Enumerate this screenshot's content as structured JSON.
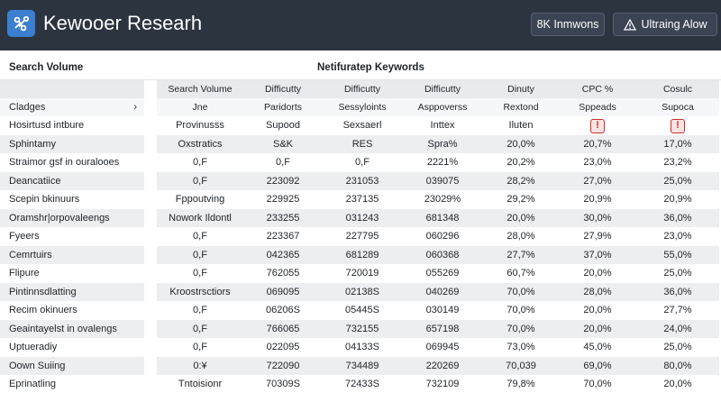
{
  "app": {
    "title": "Kewooer Researh",
    "logo_icon": "share-network-icon",
    "accent": "#3a7fd0",
    "topbar_bg": "#2c3440"
  },
  "toolbar": {
    "immwons_label": "8K Inmwons",
    "alow_label": "Ultraing Alow",
    "alow_icon": "warning-triangle-icon"
  },
  "sections": {
    "left_label": "Search Volume",
    "center_label": "Netifuratep Keywords"
  },
  "table": {
    "category_label": "Cladges",
    "columns": [
      "Search Volume",
      "Difficutty",
      "Difficutty",
      "Difficutty",
      "Dinuty",
      "CPC %",
      "Cosulc"
    ],
    "sub_headers": [
      "Jne",
      "Paridorts",
      "Sessyloints",
      "Asppoverss",
      "Rextond",
      "Sppeads",
      "Supoca"
    ],
    "rows": [
      {
        "keyword": "Hosirtusd intbure",
        "cells": [
          "Provinusss",
          "Supood",
          "Sexsaerl",
          "Inttex",
          "Iluten",
          "",
          ""
        ],
        "warn": [
          false,
          false,
          false,
          false,
          false,
          true,
          true
        ]
      },
      {
        "keyword": "Sphintamy",
        "cells": [
          "Oxstratics",
          "S&K",
          "RES",
          "Spra%",
          "20,0%",
          "20,7%",
          "17,0%"
        ]
      },
      {
        "keyword": "Straimor gsf in ouralooes",
        "cells": [
          "0,F",
          "0,F",
          "0,F",
          "2221%",
          "20,2%",
          "23,0%",
          "23,2%"
        ]
      },
      {
        "keyword": "Deancatiice",
        "cells": [
          "0,F",
          "223092",
          "231053",
          "039075",
          "28,2%",
          "27,0%",
          "25,0%"
        ]
      },
      {
        "keyword": "Scepin bkinuurs",
        "cells": [
          "Fppoutving",
          "229925",
          "237135",
          "23029%",
          "29,2%",
          "20,9%",
          "20,9%"
        ]
      },
      {
        "keyword": "Oramshr|orpovaleengs",
        "cells": [
          "Nowork Ildontl",
          "233255",
          "031243",
          "681348",
          "20,0%",
          "30,0%",
          "36,0%"
        ]
      },
      {
        "keyword": "Fyeers",
        "cells": [
          "0,F",
          "223367",
          "227795",
          "060296",
          "28,0%",
          "27,9%",
          "23,0%"
        ]
      },
      {
        "keyword": "Cemrtuirs",
        "cells": [
          "0,F",
          "042365",
          "681289",
          "060368",
          "27,7%",
          "37,0%",
          "55,0%"
        ]
      },
      {
        "keyword": "Flipure",
        "cells": [
          "0,F",
          "762055",
          "720019",
          "055269",
          "60,7%",
          "20,0%",
          "25,0%"
        ]
      },
      {
        "keyword": "Pintinnsdlatting",
        "cells": [
          "Kroostrsctiors",
          "069095",
          "02138S",
          "040269",
          "70,0%",
          "28,0%",
          "36,0%"
        ]
      },
      {
        "keyword": "Recim okinuers",
        "cells": [
          "0,F",
          "06206S",
          "05445S",
          "030149",
          "70,0%",
          "20,0%",
          "27,7%"
        ]
      },
      {
        "keyword": "Geaintayelst in ovalengs",
        "cells": [
          "0,F",
          "766065",
          "732155",
          "657198",
          "70,0%",
          "20,0%",
          "24,0%"
        ]
      },
      {
        "keyword": "Uptueradiy",
        "cells": [
          "0,F",
          "022095",
          "04133S",
          "069945",
          "73,0%",
          "45,0%",
          "25,0%"
        ]
      },
      {
        "keyword": "Oown Suiing",
        "cells": [
          "0:¥",
          "722090",
          "734489",
          "220269",
          "70,039",
          "69,0%",
          "80,0%"
        ]
      },
      {
        "keyword": "Eprinatling",
        "cells": [
          "Tntoisionr",
          "70309S",
          "72433S",
          "732109",
          "79,8%",
          "70,0%",
          "20,0%"
        ]
      }
    ]
  }
}
